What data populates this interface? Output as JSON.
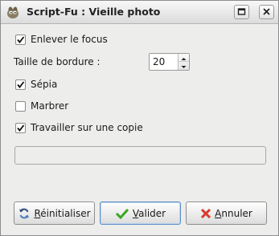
{
  "window": {
    "title": "Script-Fu : Vieille photo"
  },
  "icons": {
    "app": "gimp-wilber-icon",
    "maximize": "maximize-icon",
    "close": "close-icon",
    "reset": "reset-icon",
    "ok": "checkmark-icon",
    "cancel": "cancel-icon"
  },
  "options": {
    "defocus": {
      "label": "Enlever le focus",
      "checked": true
    },
    "border_size": {
      "label": "Taille de bordure :",
      "value": "20"
    },
    "sepia": {
      "label": "Sépia",
      "checked": true
    },
    "mottle": {
      "label": "Marbrer",
      "checked": false
    },
    "work_on_copy": {
      "label": "Travailler sur une copie",
      "checked": true
    }
  },
  "progress": {
    "text": ""
  },
  "buttons": {
    "reset": {
      "prefix": "R",
      "rest": "éinitialiser"
    },
    "ok": {
      "prefix": "V",
      "rest": "alider"
    },
    "cancel": {
      "prefix": "A",
      "rest": "nnuler"
    }
  },
  "colors": {
    "ok_accent": "#3aa61f",
    "cancel_accent": "#d83b2b"
  }
}
